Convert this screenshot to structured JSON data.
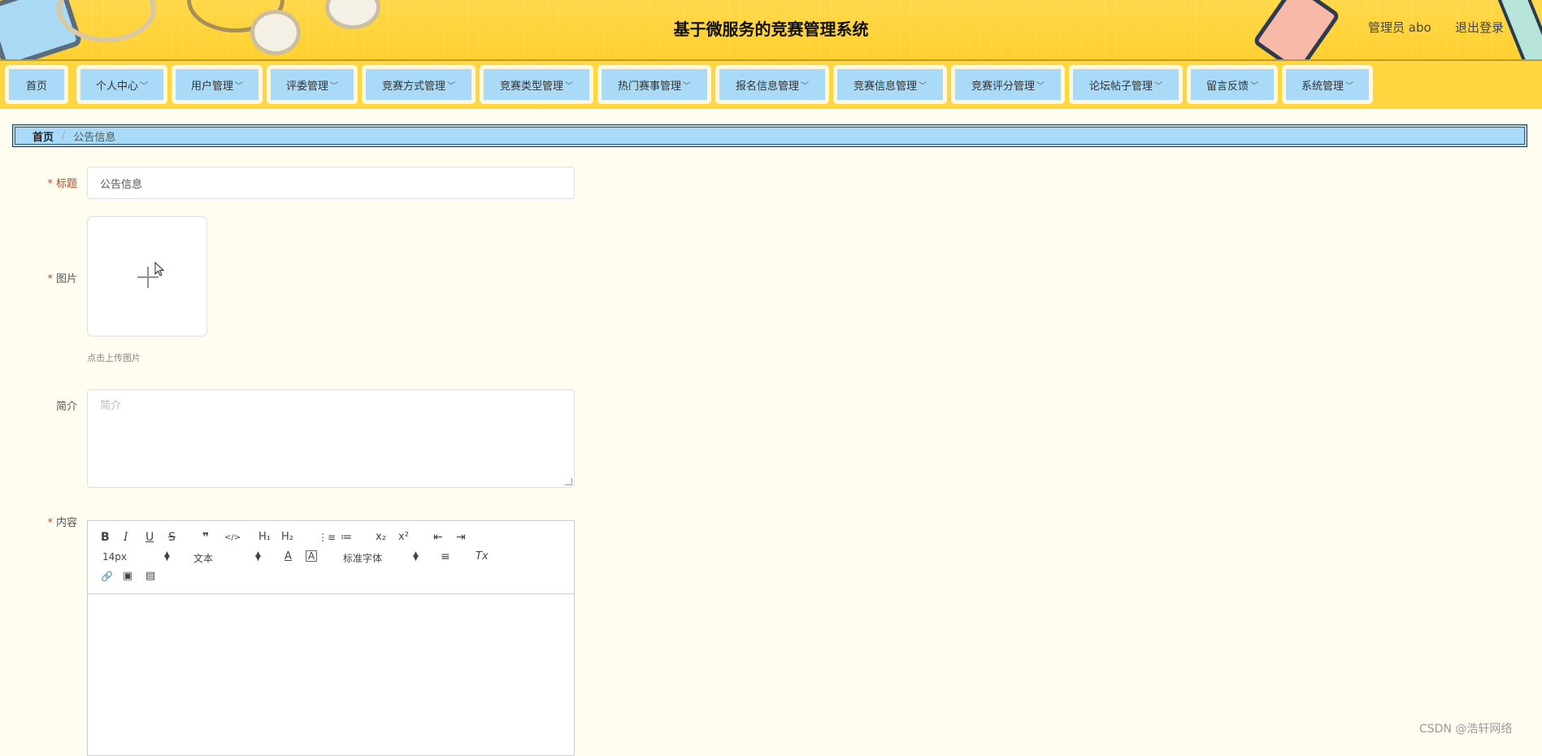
{
  "header": {
    "title": "基于微服务的竞赛管理系统",
    "user": "管理员 abo",
    "logout": "退出登录"
  },
  "nav": [
    {
      "label": "首页",
      "has_dropdown": false
    },
    {
      "label": "个人中心",
      "has_dropdown": true
    },
    {
      "label": "用户管理",
      "has_dropdown": true
    },
    {
      "label": "评委管理",
      "has_dropdown": true
    },
    {
      "label": "竞赛方式管理",
      "has_dropdown": true
    },
    {
      "label": "竞赛类型管理",
      "has_dropdown": true
    },
    {
      "label": "热门赛事管理",
      "has_dropdown": true
    },
    {
      "label": "报名信息管理",
      "has_dropdown": true
    },
    {
      "label": "竞赛信息管理",
      "has_dropdown": true
    },
    {
      "label": "竞赛评分管理",
      "has_dropdown": true
    },
    {
      "label": "论坛帖子管理",
      "has_dropdown": true
    },
    {
      "label": "留言反馈",
      "has_dropdown": true
    },
    {
      "label": "系统管理",
      "has_dropdown": true
    }
  ],
  "breadcrumb": {
    "home": "首页",
    "separator": "/",
    "current": "公告信息"
  },
  "form": {
    "title_label": "标题",
    "title_value": "公告信息",
    "image_label": "图片",
    "upload_hint": "点击上传图片",
    "intro_label": "简介",
    "intro_placeholder": "简介",
    "content_label": "内容",
    "required_mark": "*"
  },
  "editor": {
    "font_size": "14px",
    "block_format": "文本",
    "font_family": "标准字体",
    "buttons": {
      "bold": "B",
      "italic": "I",
      "underline": "U",
      "strike": "S",
      "blockquote": "❞",
      "code": "</>",
      "h1": "H₁",
      "h2": "H₂",
      "ordered_list": "⋮≡",
      "bullet_list": "≔",
      "subscript": "x₂",
      "superscript": "x²",
      "outdent": "⇤",
      "indent": "⇥",
      "font_color": "A",
      "background_color": "A",
      "align": "≡",
      "clean": "Tx",
      "link": "🔗",
      "image": "▣",
      "video": "▤"
    }
  },
  "watermark": "CSDN @浩轩网络",
  "colors": {
    "header_bg": "#ffd540",
    "nav_item_bg": "#a9dbf8",
    "page_bg": "#fffdf0",
    "required": "#e03c2c"
  }
}
